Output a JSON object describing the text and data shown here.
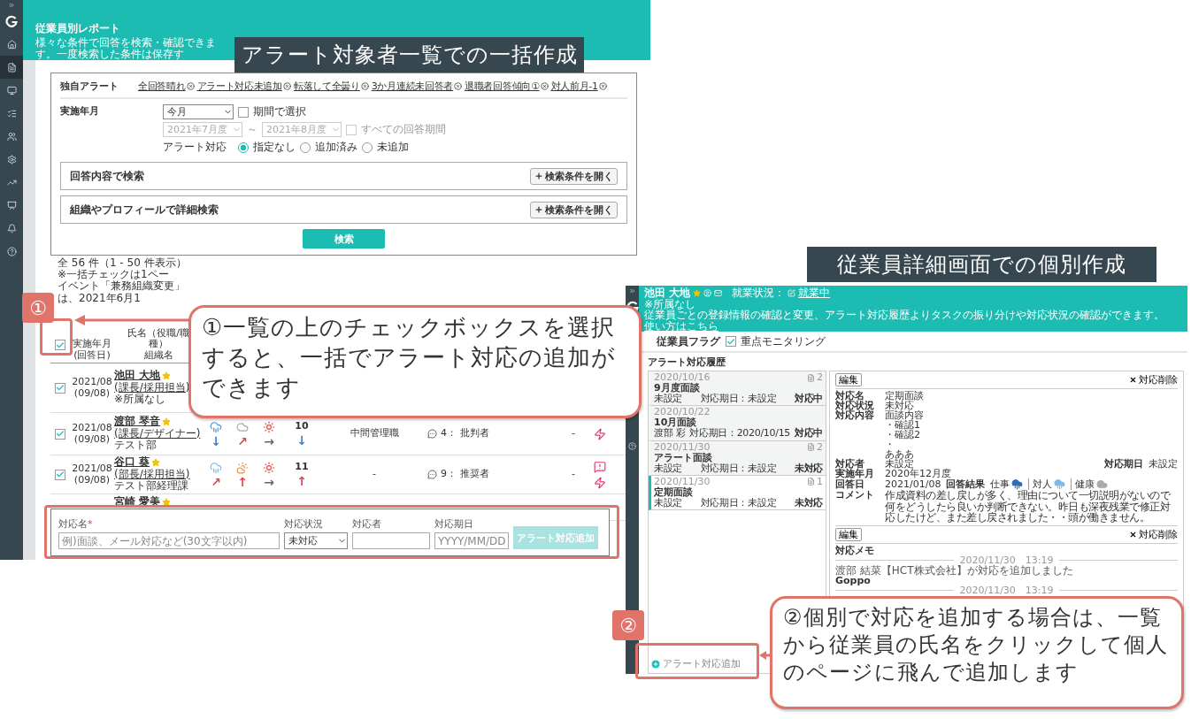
{
  "left_screen": {
    "sidebar": {
      "toggle": "»",
      "items": [
        {
          "selected": false
        },
        {
          "selected": true
        },
        {
          "selected": false
        },
        {
          "selected": false
        },
        {
          "selected": false
        },
        {
          "selected": false
        },
        {
          "selected": false
        },
        {
          "selected": false
        },
        {
          "selected": false
        },
        {
          "selected": false
        }
      ]
    },
    "header": {
      "title": "従業員別レポート",
      "subtitle": "様々な条件で回答を検索・確認できます。一度検索した条件は保存す"
    },
    "filters": {
      "alert_label": "独自アラート",
      "alert_chips": [
        "全回答晴れ",
        "アラート対応未追加",
        "転落して全曇り",
        "3か月連続未回答者",
        "退職者回答傾向①",
        "対人前月-1"
      ],
      "period_label": "実施年月",
      "period_select": "今月",
      "range_checkbox": {
        "label": "期間で選択",
        "checked": false
      },
      "range_from": "2021年7月度",
      "range_sep": "～",
      "range_to": "2021年8月度",
      "all_periods": {
        "label": "すべての回答期間",
        "checked": false
      },
      "range_disabled": true,
      "alert_response_label": "アラート対応",
      "alert_response_options": [
        {
          "label": "指定なし",
          "selected": true
        },
        {
          "label": "追加済み",
          "selected": false
        },
        {
          "label": "未追加",
          "selected": false
        }
      ],
      "sections": [
        {
          "title": "回答内容で検索",
          "button": "検索条件を開く"
        },
        {
          "title": "組織やプロフィールで詳細検索",
          "button": "検索条件を開く"
        }
      ],
      "search_button": "検索"
    },
    "results": {
      "summary": "全 56 件（1 - 50 件表示）※一括チェックは1ペー",
      "notice": "イベント「兼務組織変更」は、2021年6月1",
      "header": {
        "checked": true,
        "date": "実施年月",
        "date_sub": "(回答日)",
        "name": "氏名（役職/職種）",
        "org": "組織名"
      },
      "rows": [
        {
          "checked": true,
          "date": "2021/08",
          "answered": "(09/08)",
          "name": "池田 大地",
          "role": "(課長/採用担当)",
          "org": "※所属なし"
        },
        {
          "checked": true,
          "date": "2021/08",
          "answered": "(09/08)",
          "name": "渡部 琴音",
          "role": "(課長/デザイナー)",
          "org": "テスト部",
          "weather": [
            {
              "kind": "rain",
              "arrow": "↓",
              "color": "#3b82c4"
            },
            {
              "kind": "cloud",
              "arrow": "↗",
              "color": "#e0454c"
            },
            {
              "kind": "sun",
              "arrow": "→",
              "color": "#666666"
            }
          ],
          "score": "10",
          "score_trend": {
            "arrow": "↓",
            "color": "#3b82c4"
          },
          "position": "中間管理職",
          "comments": "4：",
          "nps": "批判者",
          "dash": "-",
          "alerts": [
            {
              "kind": "lightning"
            }
          ]
        },
        {
          "checked": true,
          "date": "2021/08",
          "answered": "(09/08)",
          "name": "谷口 葵",
          "role": "(部長/採用担当)",
          "org": "テスト部経理課",
          "weather": [
            {
              "kind": "rain_light",
              "arrow": "↗",
              "color": "#e0454c"
            },
            {
              "kind": "partly",
              "arrow": "↑",
              "color": "#e0454c"
            },
            {
              "kind": "sun",
              "arrow": "→",
              "color": "#666666"
            }
          ],
          "score": "11",
          "score_trend": {
            "arrow": "↑",
            "color": "#e0454c"
          },
          "position": "-",
          "comments": "9：",
          "nps": "推奨者",
          "dash": "-",
          "alerts": [
            {
              "kind": "warning"
            },
            {
              "kind": "lightning"
            }
          ]
        },
        {
          "name": "宮崎 愛美"
        }
      ]
    },
    "bulk_form": {
      "fields": [
        {
          "kind": "input",
          "label": "対応名",
          "required_mark": "*",
          "placeholder": "例)面談、メール対応など(30文字以内)"
        },
        {
          "kind": "select",
          "label": "対応状況",
          "value": "未対応"
        },
        {
          "kind": "input",
          "label": "対応者"
        },
        {
          "kind": "input",
          "label": "対応期日",
          "placeholder": "YYYY/MM/DD"
        }
      ],
      "submit": {
        "label": "アラート対応追加",
        "disabled": true
      }
    }
  },
  "right_screen": {
    "sidebar": {
      "toggle": "»"
    },
    "header": {
      "name": "池田 大地",
      "status_label": "就業状況：",
      "status_link": "就業中",
      "affiliation": "※所属なし",
      "description": "従業員ごとの登録情報の確認と変更、アラート対応履歴よりタスクの振り分けや対応状況の確認ができます。",
      "help_link": "使い方はこちら"
    },
    "flags": {
      "label": "従業員フラグ",
      "items": [
        {
          "label": "重点モニタリング",
          "checked": true
        }
      ]
    },
    "history": {
      "title": "アラート対応履歴",
      "items": [
        {
          "date": "2020/10/16",
          "count": "2",
          "title": "9月度面談",
          "assignee": "未設定",
          "due": "対応期日：未設定",
          "status": "対応中",
          "selected": false
        },
        {
          "date": "2020/10/22",
          "title": "10月面談",
          "assignee": "渡部 彩",
          "due": "対応期日：2020/10/15",
          "status": "対応中",
          "selected": false
        },
        {
          "date": "2020/11/30",
          "count": "2",
          "title": "アラート面談",
          "assignee": "未設定",
          "due": "対応期日：未設定",
          "status": "未対応",
          "selected": false
        },
        {
          "date": "2020/11/30",
          "count": "1",
          "title": "定期面談",
          "assignee": "未設定",
          "due": "対応期日：未設定",
          "status": "未対応",
          "selected": true
        }
      ],
      "add_button": "アラート対応追加",
      "detail": {
        "edit_button": "編集",
        "delete_button": "対応削除",
        "fields": [
          {
            "label": "対応名",
            "lines": [
              "定期面談"
            ]
          },
          {
            "label": "対応状況",
            "lines": [
              "未対応"
            ]
          },
          {
            "label": "対応内容",
            "lines": [
              "面談内容",
              "・確認1",
              "・確認2",
              "・",
              "あああ"
            ]
          }
        ],
        "assignee": {
          "label": "対応者",
          "value": "未設定"
        },
        "due": {
          "label": "対応期日",
          "value": "未設定"
        },
        "period": {
          "label": "実施年月",
          "value": "2020年12月度"
        },
        "answer": {
          "label": "回答日",
          "date": "2021/01/08",
          "result_label": "回答結果",
          "results": [
            {
              "label": "仕事",
              "kind": "rain",
              "color": "#2d6db5"
            },
            {
              "label": "対人",
              "kind": "rain",
              "color": "#7cb8e8"
            },
            {
              "label": "健康",
              "kind": "cloud",
              "color": "#aaaaaa"
            }
          ]
        },
        "comment": {
          "label": "コメント",
          "text": "作成資料の差し戻しが多く、理由について一切説明がないので何をどうしたら良いか判断できない。昨日も深夜残業で修正対応したけど、また差し戻されました・・頭が働きません。"
        },
        "edit_button_2": "編集",
        "delete_button_2": "対応削除",
        "memo": {
          "title": "対応メモ",
          "entries": [
            {
              "time": "2020/11/30　13:19",
              "text": "渡部 結菜【HCT株式会社】が対応を追加しました",
              "note": "Goppo"
            },
            {
              "time": "2020/11/30　13:19"
            }
          ]
        }
      }
    }
  },
  "annotations": {
    "bulk_title": "アラート対象者一覧での一括作成",
    "individual_title": "従業員詳細画面での個別作成",
    "callouts": [
      {
        "badge": "①",
        "text": "①一覧の上のチェックボックスを選択すると、一括でアラート対応の追加ができます"
      },
      {
        "badge": "②",
        "text": "②個別で対応を追加する場合は、一覧から従業員の氏名をクリックして個人のページに飛んで追加します"
      }
    ]
  }
}
